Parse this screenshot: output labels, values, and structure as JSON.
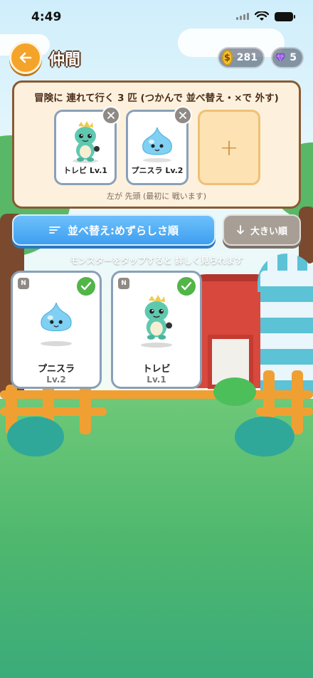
{
  "status_bar": {
    "time": "4:49"
  },
  "header": {
    "back_icon": "arrow-left-icon",
    "title": "仲間",
    "coins": {
      "icon": "coin-icon",
      "symbol": "$",
      "value": "281"
    },
    "gems": {
      "icon": "gem-icon",
      "value": "5"
    }
  },
  "party": {
    "title": "冒険に 連れて行く 3 匹 (つかんで 並べ替え・×で 外す)",
    "slots": [
      {
        "name": "トレビ Lv.1",
        "monster": "trebi"
      },
      {
        "name": "プニスラ Lv.2",
        "monster": "punisura"
      }
    ],
    "add_symbol": "+",
    "note": "左が 先頭 (最初に 戦います)"
  },
  "sort": {
    "label": "並べ替え:めずらしさ順",
    "size_label": "大きい順"
  },
  "hint": "モンスターをタップすると 詳しく見られます",
  "monsters": [
    {
      "rank": "N",
      "name": "プニスラ",
      "level": "Lv.2",
      "selected": true,
      "monster": "punisura"
    },
    {
      "rank": "N",
      "name": "トレビ",
      "level": "Lv.1",
      "selected": true,
      "monster": "trebi"
    }
  ],
  "colors": {
    "accent_orange": "#f4a42a",
    "sort_blue": "#3e9ff0",
    "check_green": "#52b548",
    "panel_border": "#8a5a32"
  }
}
